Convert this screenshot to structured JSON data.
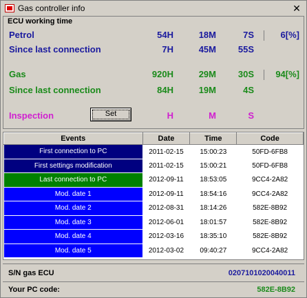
{
  "window": {
    "title": "Gas controller info",
    "close": "✕"
  },
  "ecu": {
    "header": "ECU working time",
    "petrol": {
      "label": "Petrol",
      "h": "54H",
      "m": "18M",
      "s": "7S",
      "pct": "6[%]"
    },
    "petrol_since": {
      "label": "Since last connection",
      "h": "7H",
      "m": "45M",
      "s": "55S"
    },
    "gas": {
      "label": "Gas",
      "h": "920H",
      "m": "29M",
      "s": "30S",
      "pct": "94[%]"
    },
    "gas_since": {
      "label": "Since last connection",
      "h": "84H",
      "m": "19M",
      "s": "4S"
    },
    "inspection": {
      "label": "Inspection",
      "button": "Set",
      "h": "H",
      "m": "M",
      "s": "S"
    }
  },
  "colors": {
    "petrol": "#1a1a9e",
    "gas": "#1a8a1a",
    "inspection": "#d020d0",
    "row_first": "#000080",
    "row_last": "#008000",
    "row_mod": "#0000ff"
  },
  "events_table": {
    "headers": [
      "Events",
      "Date",
      "Time",
      "Code"
    ],
    "rows": [
      {
        "event": "First connection to PC",
        "date": "2011-02-15",
        "time": "15:00:23",
        "code": "50FD-6FB8",
        "color": "#000080"
      },
      {
        "event": "First settings modification",
        "date": "2011-02-15",
        "time": "15:00:21",
        "code": "50FD-6FB8",
        "color": "#000080"
      },
      {
        "event": "Last connection to PC",
        "date": "2012-09-11",
        "time": "18:53:05",
        "code": "9CC4-2A82",
        "color": "#008000"
      },
      {
        "event": "Mod. date 1",
        "date": "2012-09-11",
        "time": "18:54:16",
        "code": "9CC4-2A82",
        "color": "#0000ff"
      },
      {
        "event": "Mod. date 2",
        "date": "2012-08-31",
        "time": "18:14:26",
        "code": "582E-8B92",
        "color": "#0000ff"
      },
      {
        "event": "Mod. date 3",
        "date": "2012-06-01",
        "time": "18:01:57",
        "code": "582E-8B92",
        "color": "#0000ff"
      },
      {
        "event": "Mod. date 4",
        "date": "2012-03-16",
        "time": "18:35:10",
        "code": "582E-8B92",
        "color": "#0000ff"
      },
      {
        "event": "Mod. date 5",
        "date": "2012-03-02",
        "time": "09:40:27",
        "code": "9CC4-2A82",
        "color": "#0000ff"
      }
    ]
  },
  "footer": {
    "sn_label": "S/N gas ECU",
    "sn_value": "0207101020040011",
    "pc_label": "Your PC code:",
    "pc_value": "582E-8B92"
  }
}
